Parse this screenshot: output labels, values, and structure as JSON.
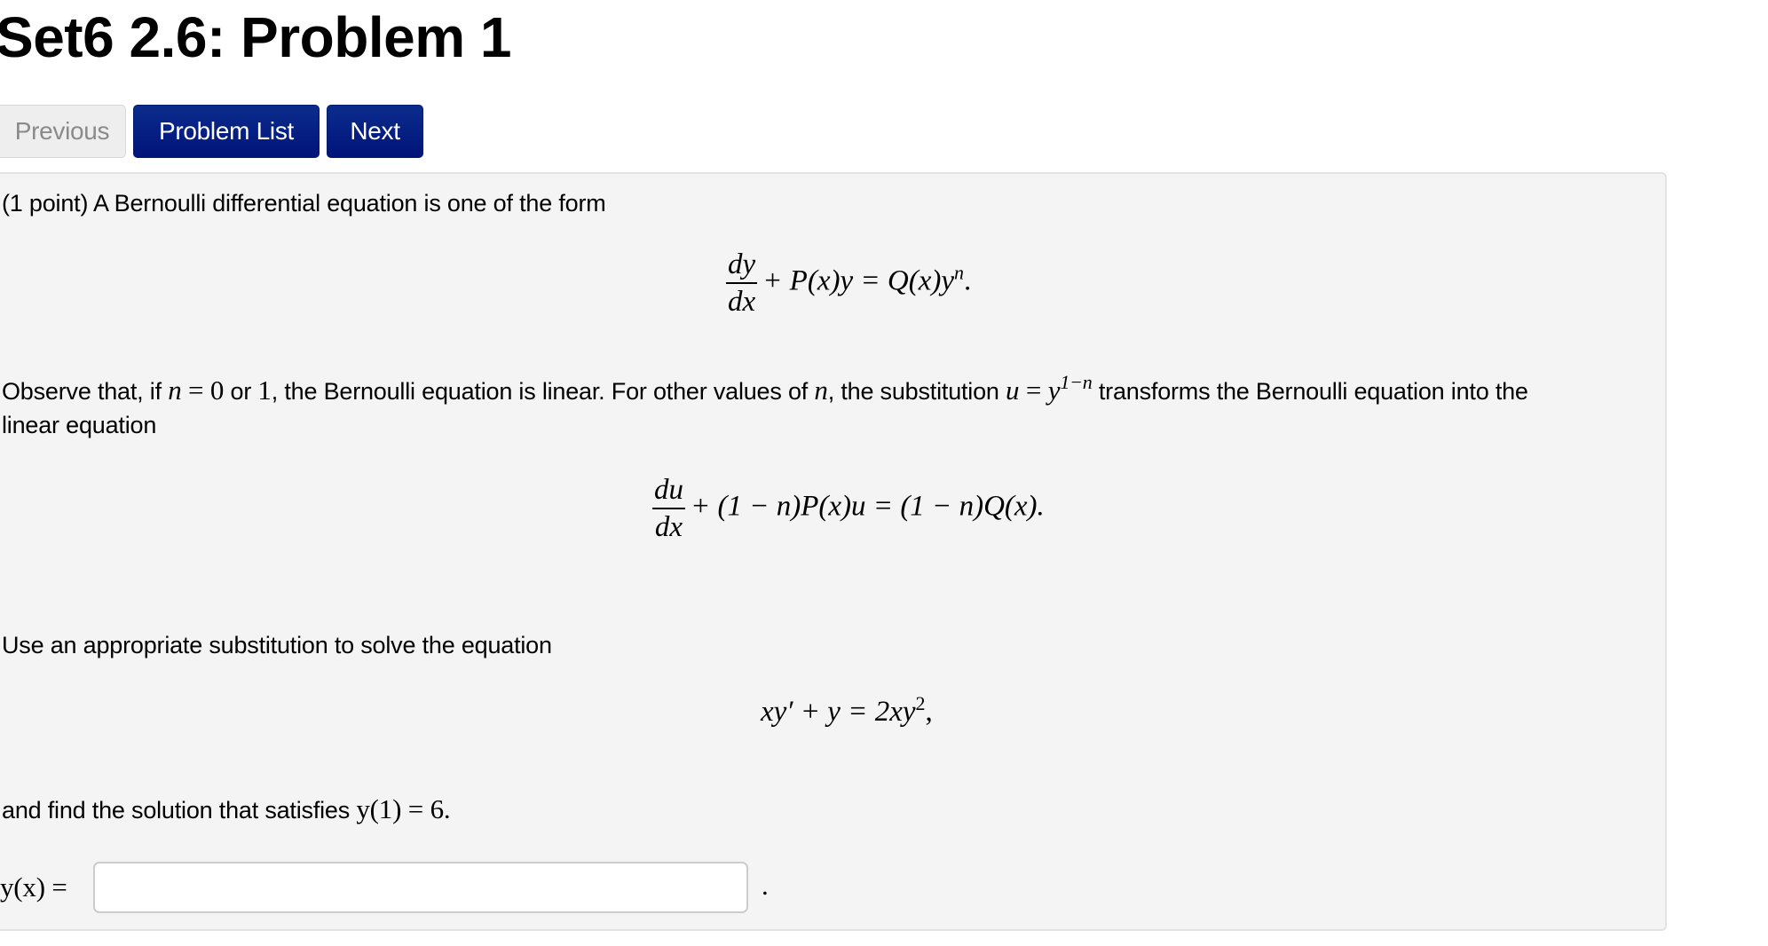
{
  "page": {
    "title": "Set6 2.6: Problem 1"
  },
  "nav": {
    "previous_label": "Previous",
    "problem_list_label": "Problem List",
    "next_label": "Next",
    "primary_color": "#0b2c8c"
  },
  "problem": {
    "intro": "(1 point) A Bernoulli differential equation is one of the form",
    "eq1": {
      "numerator": "dy",
      "denominator": "dx",
      "rest": "+ P(x)y = Q(x)y",
      "exponent": "n",
      "end": "."
    },
    "observe": {
      "part1": "Observe that, if ",
      "n_var": "n",
      "eq": " = ",
      "zero": "0",
      "or": " or ",
      "one": "1",
      "part2": ", the Bernoulli equation is linear. For other values of ",
      "n_var2": "n",
      "part3": ", the substitution ",
      "u_var": "u",
      "eq2": " = ",
      "y_var": "y",
      "exponent": "1−n",
      "part4": " transforms the Bernoulli equation into the",
      "line2": "linear equation"
    },
    "eq2": {
      "numerator": "du",
      "denominator": "dx",
      "rest": "+ (1 − n)P(x)u = (1 − n)Q(x)."
    },
    "instruction": "Use an appropriate substitution to solve the equation",
    "eq3": {
      "lhs": "xy′ + y = 2xy",
      "exponent": "2",
      "end": ","
    },
    "condition": {
      "text": "and find the solution that satisfies ",
      "math": "y(1) = 6."
    },
    "answer": {
      "label": "y(x) =",
      "value": "",
      "placeholder": "",
      "trailing": "."
    }
  }
}
